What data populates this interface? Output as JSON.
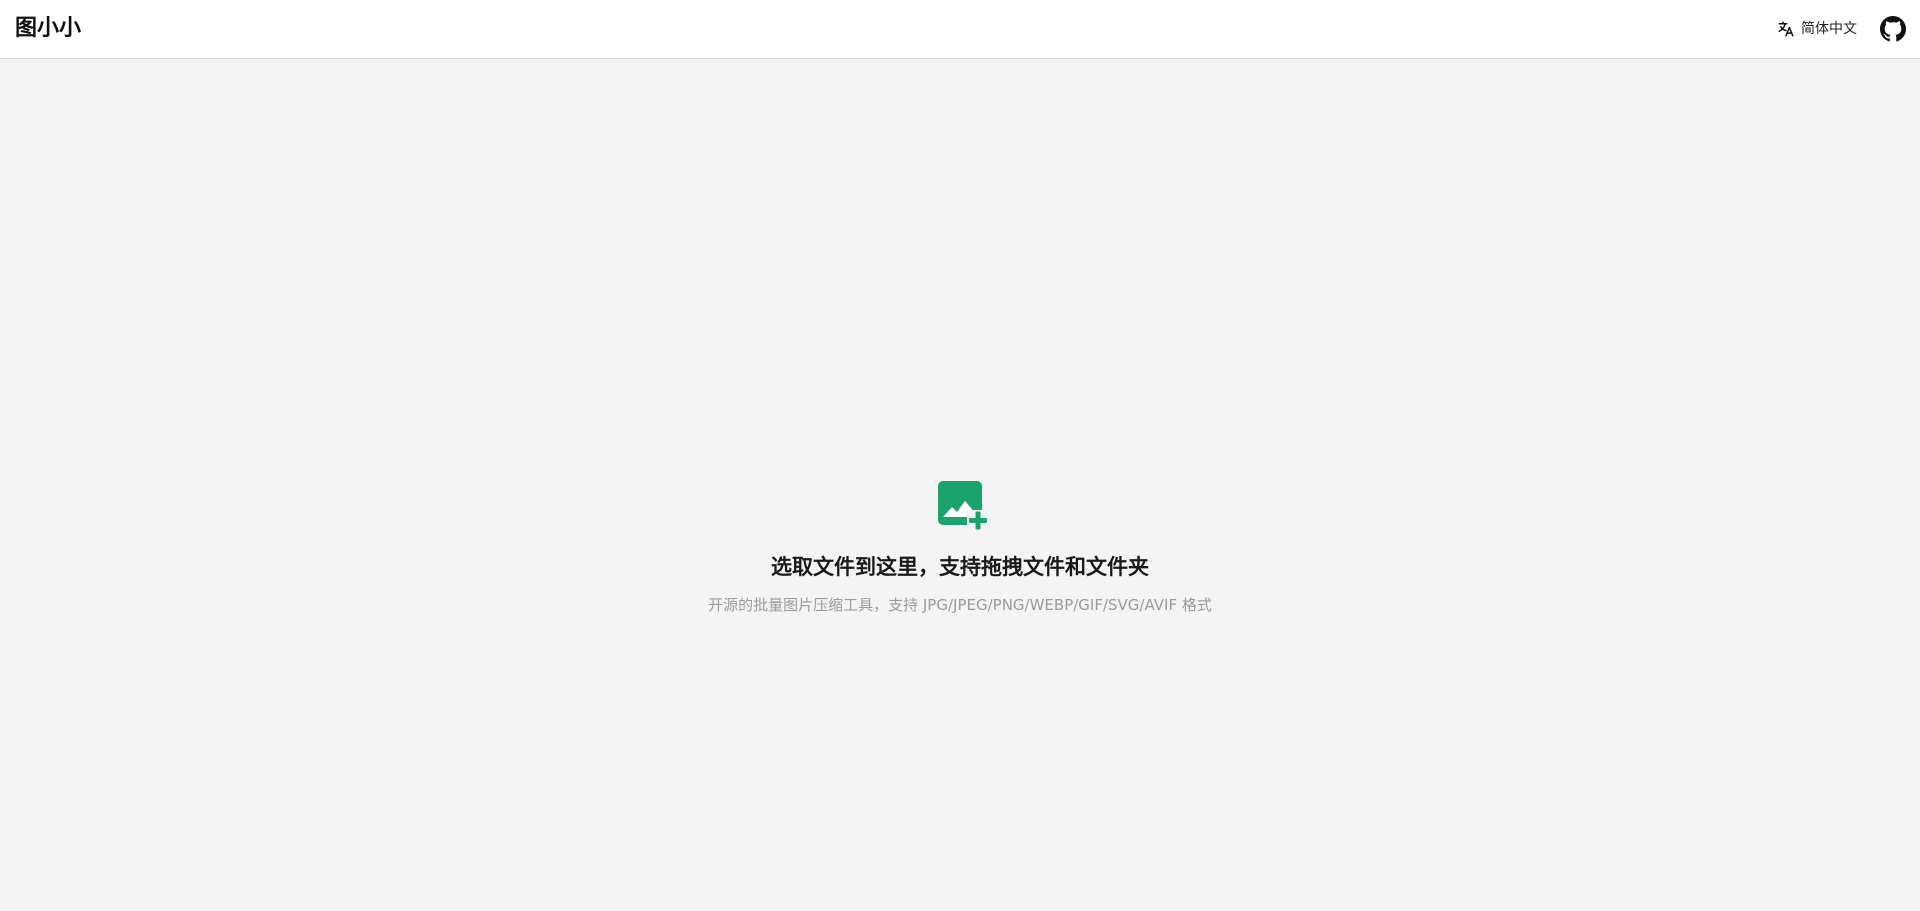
{
  "header": {
    "logo": "图小小",
    "language": {
      "icon": "translate-icon",
      "label": "简体中文"
    },
    "github_icon": "github-icon"
  },
  "main": {
    "upload_icon": "add-image-icon",
    "title": "选取文件到这里，支持拖拽文件和文件夹",
    "description": "开源的批量图片压缩工具，支持 JPG/JPEG/PNG/WEBP/GIF/SVG/AVIF 格式"
  },
  "colors": {
    "accent": "#1aa36a",
    "background": "#f4f4f4",
    "header_background": "#ffffff",
    "muted_text": "#9a9a9a"
  }
}
